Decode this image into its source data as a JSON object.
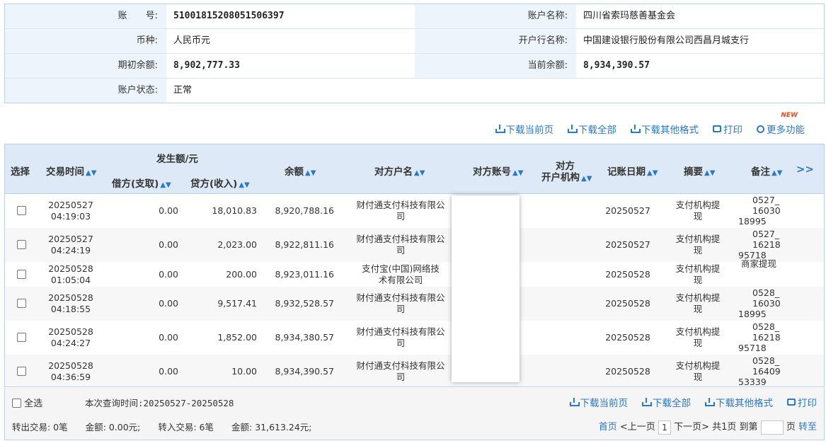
{
  "account": {
    "account_no_label": "账　　号:",
    "account_no": "51001815208051506397",
    "account_name_label": "账户名称:",
    "account_name": "四川省索玛慈善基金会",
    "currency_label": "币种:",
    "currency": "人民币元",
    "bank_label": "开户行名称:",
    "bank": "中国建设银行股份有限公司西昌月城支行",
    "opening_label": "期初余额:",
    "opening": "8,902,777.33",
    "current_label": "当前余额:",
    "current": "8,934,390.57",
    "status_label": "账户状态:",
    "status": "正常"
  },
  "toolbar": {
    "download_page": "下载当前页",
    "download_all": "下载全部",
    "download_other": "下载其他格式",
    "print": "打印",
    "more": "更多功能",
    "new_badge": "NEW"
  },
  "table": {
    "headers": {
      "select": "选择",
      "time": "交易时间",
      "amount_group": "发生额/元",
      "debit": "借方(支取)",
      "credit": "贷方(收入)",
      "balance": "余额",
      "party_name": "对方户名",
      "party_account": "对方账号",
      "party_bank_1": "对方",
      "party_bank_2": "开户机构",
      "post_date": "记账日期",
      "summary": "摘要",
      "remark": "备注",
      "expand": ">>"
    },
    "rows": [
      {
        "date": "20250527",
        "time": "04:19:03",
        "debit": "0.00",
        "credit": "18,010.83",
        "balance": "8,920,788.16",
        "party1": "财付通支付科技有限公",
        "party2": "司",
        "post": "20250527",
        "sum1": "支付机构提",
        "sum2": "现",
        "r1": "0527_",
        "r2": "16030",
        "r3": "18995"
      },
      {
        "date": "20250527",
        "time": "04:24:19",
        "debit": "0.00",
        "credit": "2,023.00",
        "balance": "8,922,811.16",
        "party1": "财付通支付科技有限公",
        "party2": "司",
        "post": "20250527",
        "sum1": "支付机构提",
        "sum2": "现",
        "r1": "0527_",
        "r2": "16218",
        "r3": "95718"
      },
      {
        "date": "20250528",
        "time": "01:05:04",
        "debit": "0.00",
        "credit": "200.00",
        "balance": "8,923,011.16",
        "party1": "支付宝(中国)网络技",
        "party2": "术有限公司",
        "post": "20250528",
        "sum1": "支付机构提",
        "sum2": "现",
        "r1": "",
        "r2": "商家提现",
        "r3": ""
      },
      {
        "date": "20250528",
        "time": "04:18:55",
        "debit": "0.00",
        "credit": "9,517.41",
        "balance": "8,932,528.57",
        "party1": "财付通支付科技有限公",
        "party2": "司",
        "post": "20250528",
        "sum1": "支付机构提",
        "sum2": "现",
        "r1": "0528_",
        "r2": "16030",
        "r3": "18995"
      },
      {
        "date": "20250528",
        "time": "04:24:27",
        "debit": "0.00",
        "credit": "1,852.00",
        "balance": "8,934,380.57",
        "party1": "财付通支付科技有限公",
        "party2": "司",
        "post": "20250528",
        "sum1": "支付机构提",
        "sum2": "现",
        "r1": "0528_",
        "r2": "16218",
        "r3": "95718"
      },
      {
        "date": "20250528",
        "time": "04:36:59",
        "debit": "0.00",
        "credit": "10.00",
        "balance": "8,934,390.57",
        "party1": "财付通支付科技有限公",
        "party2": "司",
        "post": "20250528",
        "sum1": "支付机构提",
        "sum2": "现",
        "r1": "0528_",
        "r2": "16409",
        "r3": "53339"
      }
    ]
  },
  "footer": {
    "select_all": "全选",
    "query_time": "本次查询时间:20250527-20250528",
    "download_page": "下载当前页",
    "download_all": "下载全部",
    "download_other": "下载其他格式",
    "print": "打印",
    "summary": "转出交易: 0笔　　金额: 0.00元;　　转入交易: 6笔　　金额: 31,613.24元;",
    "first": "首页",
    "prev": "<上一页",
    "page_current": "1",
    "next": "下一页>",
    "total": "共1页",
    "goto": "到第",
    "page_unit": "页",
    "go": "转至"
  },
  "colors": {
    "accent": "#2b78c5",
    "header_bg": "#dde9f6",
    "label_bg": "#eef4fb",
    "border": "#b7d1e6"
  }
}
